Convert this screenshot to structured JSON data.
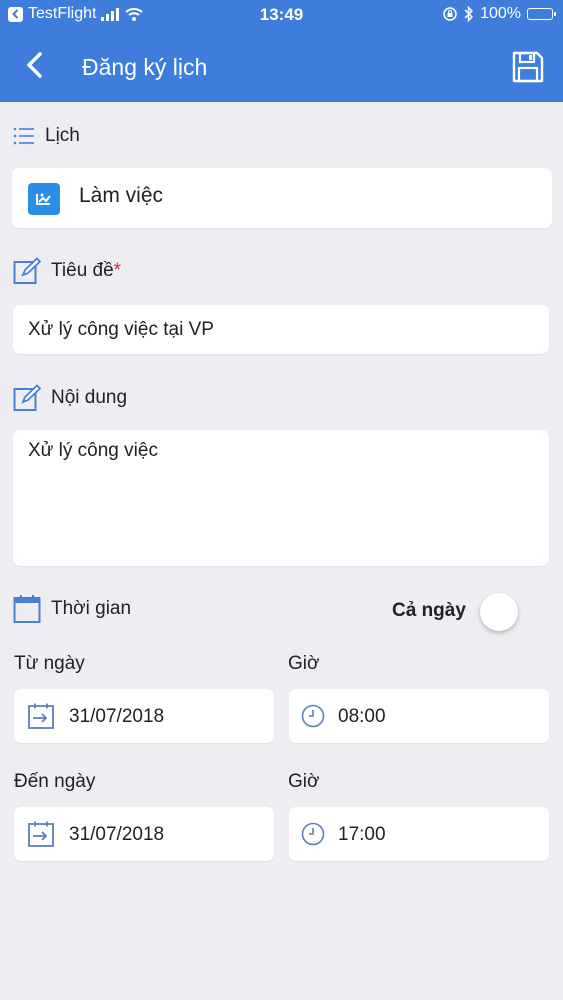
{
  "status_bar": {
    "app": "TestFlight",
    "time": "13:49",
    "battery": "100%"
  },
  "nav": {
    "title": "Đăng ký lịch"
  },
  "calendar_section": {
    "label": "Lịch",
    "value": "Làm việc"
  },
  "title_section": {
    "label": "Tiêu đề",
    "required_mark": "*",
    "value": "Xử lý công việc tại VP"
  },
  "content_section": {
    "label": "Nội dung",
    "value": "Xử lý công việc"
  },
  "time_section": {
    "label": "Thời gian",
    "all_day_label": "Cả ngày",
    "all_day_on": false
  },
  "from": {
    "date_label": "Từ ngày",
    "date_value": "31/07/2018",
    "time_label": "Giờ",
    "time_value": "08:00"
  },
  "to": {
    "date_label": "Đến ngày",
    "date_value": "31/07/2018",
    "time_label": "Giờ",
    "time_value": "17:00"
  },
  "colors": {
    "accent": "#3e7ddc",
    "background": "#ededf2",
    "required": "#e0273a",
    "icon": "#4a7fd6"
  }
}
